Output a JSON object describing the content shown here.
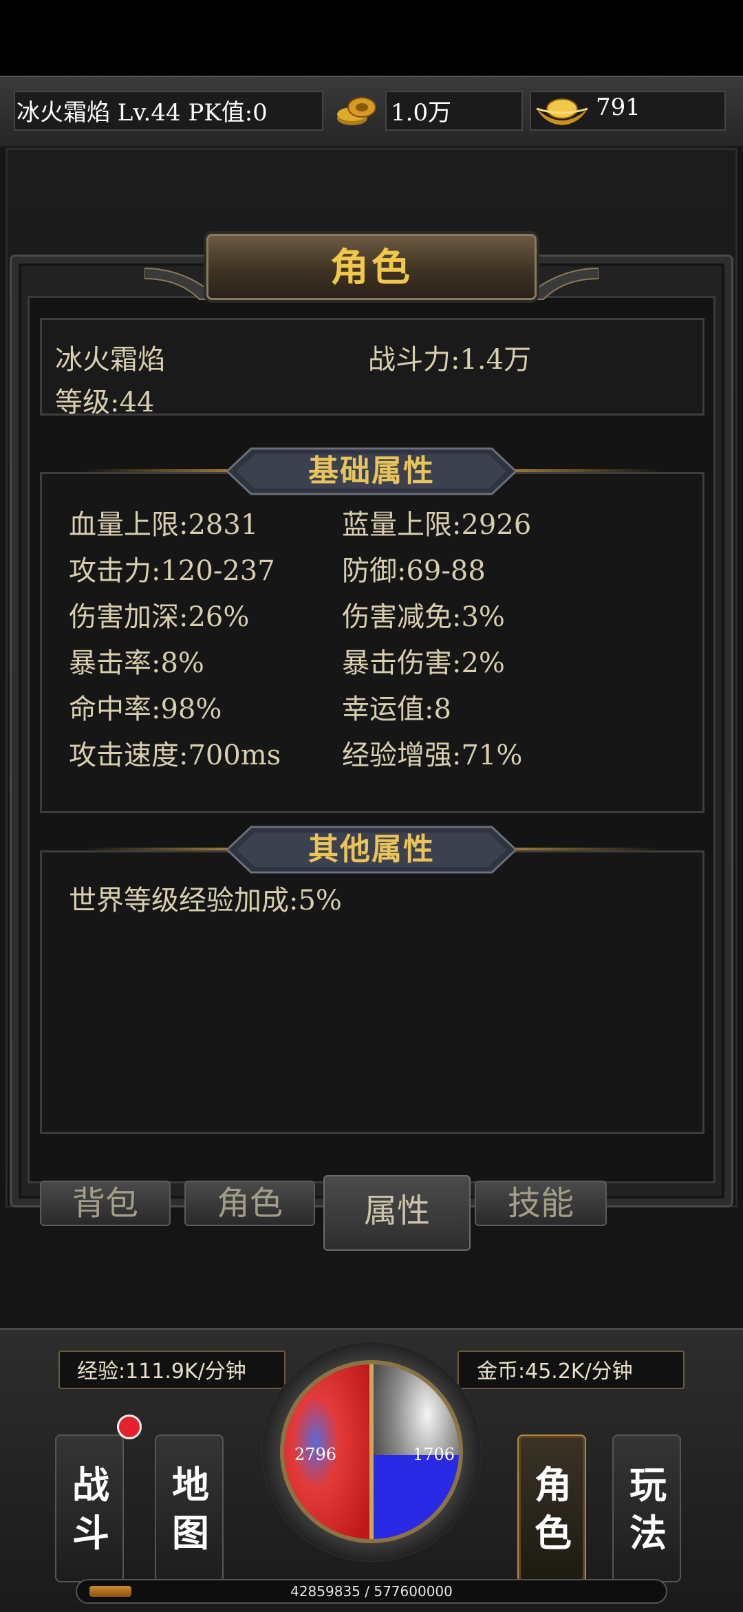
{
  "status_bar": {
    "player": "冰火霜焰  Lv.44 PK值:0",
    "gold": "1.0万",
    "ingot": "791",
    "icons": [
      "coin-stack-icon",
      "gold-ingot-icon"
    ]
  },
  "panel": {
    "title": "角色",
    "char_name": "冰火霜焰",
    "combat_power": "战斗力:1.4万",
    "level": "等级:44"
  },
  "basic": {
    "title": "基础属性",
    "stats": [
      "血量上限:2831",
      "蓝量上限:2926",
      "攻击力:120-237",
      "防御:69-88",
      "伤害加深:26%",
      "伤害减免:3%",
      "暴击率:8%",
      "暴击伤害:2%",
      "命中率:98%",
      "幸运值:8",
      "攻击速度:700ms",
      "经验增强:71%"
    ]
  },
  "other": {
    "title": "其他属性",
    "stats": [
      "世界等级经验加成:5%"
    ]
  },
  "tabs": [
    "背包",
    "角色",
    "属性",
    "技能"
  ],
  "active_tab": "属性",
  "hud": {
    "exp_rate": "经验:111.9K/分钟",
    "gold_rate": "金币:45.2K/分钟",
    "hp": "2796",
    "mp": "1706",
    "left_buttons": [
      [
        "战",
        "斗"
      ],
      [
        "地",
        "图"
      ]
    ],
    "right_buttons": [
      [
        "角",
        "色"
      ],
      [
        "玩",
        "法"
      ]
    ],
    "exp_text": "42859835 / 577600000",
    "exp_fraction": 0.074,
    "colors": {
      "hp": "#e0202a",
      "mp": "#2a2ae6",
      "accent": "#f2c84a"
    }
  }
}
